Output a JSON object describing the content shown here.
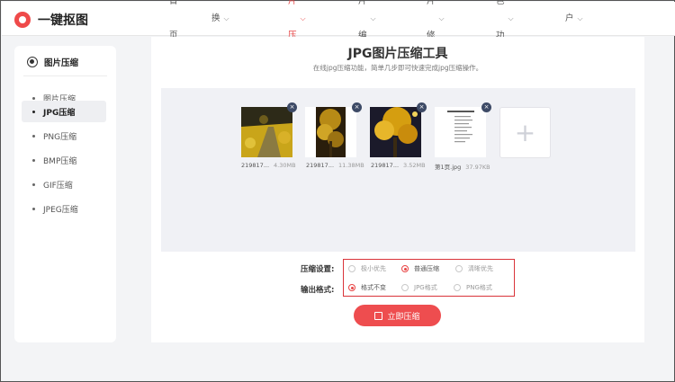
{
  "brand": {
    "name": "一键抠图",
    "color": "#ef4a4a"
  },
  "nav": {
    "items": [
      {
        "label": "首页",
        "has_chevron": false,
        "active": false
      },
      {
        "label": "抠图换背景",
        "has_chevron": true,
        "active": false
      },
      {
        "label": "图片压缩",
        "has_chevron": true,
        "active": true
      },
      {
        "label": "图片编辑",
        "has_chevron": true,
        "active": false
      },
      {
        "label": "照片修复",
        "has_chevron": true,
        "active": false
      },
      {
        "label": "特色功能",
        "has_chevron": true,
        "active": false
      },
      {
        "label": "客户端",
        "has_chevron": true,
        "active": false
      }
    ],
    "chevron_glyph": "⌵"
  },
  "sidebar": {
    "header": "图片压缩",
    "items": [
      {
        "label": "图片压缩",
        "active": false
      },
      {
        "label": "JPG压缩",
        "active": true
      },
      {
        "label": "PNG压缩",
        "active": false
      },
      {
        "label": "BMP压缩",
        "active": false
      },
      {
        "label": "GIF压缩",
        "active": false
      },
      {
        "label": "JPEG压缩",
        "active": false
      }
    ]
  },
  "main": {
    "title": "JPG图片压缩工具",
    "subtitle": "在线jpg压缩功能，简单几步即可快速完成jpg压缩操作。",
    "files": [
      {
        "name": "219817...",
        "size": "4.30MB"
      },
      {
        "name": "219817...",
        "size": "11.38MB"
      },
      {
        "name": "219817...",
        "size": "3.52MB"
      },
      {
        "name": "第1页.jpg",
        "size": "37.97KB"
      }
    ],
    "remove_glyph": "×",
    "add_glyph": "+",
    "compression": {
      "label": "压缩设置:",
      "options": [
        {
          "label": "极小优先",
          "selected": false
        },
        {
          "label": "普通压缩",
          "selected": true
        },
        {
          "label": "清晰优先",
          "selected": false
        }
      ]
    },
    "format": {
      "label": "输出格式:",
      "options": [
        {
          "label": "格式不变",
          "selected": true
        },
        {
          "label": "JPG格式",
          "selected": false
        },
        {
          "label": "PNG格式",
          "selected": false
        }
      ]
    },
    "compress_button": "立即压缩",
    "accent_color": "#e84545"
  }
}
